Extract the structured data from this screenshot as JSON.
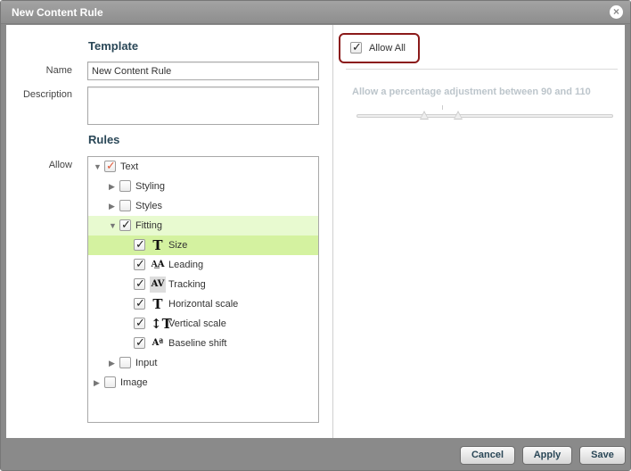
{
  "window": {
    "title": "New Content Rule"
  },
  "template": {
    "heading": "Template",
    "name_label": "Name",
    "name_value": "New Content Rule",
    "description_label": "Description",
    "description_value": ""
  },
  "rules": {
    "heading": "Rules",
    "allow_label": "Allow",
    "tree": [
      {
        "label": "Text",
        "expanded": true,
        "checked": true,
        "partial": true
      },
      {
        "label": "Styling",
        "expanded": false,
        "checked": false
      },
      {
        "label": "Styles",
        "expanded": false,
        "checked": false
      },
      {
        "label": "Fitting",
        "expanded": true,
        "checked": true
      },
      {
        "label": "Size",
        "checked": true,
        "icon": "font-size-icon"
      },
      {
        "label": "Leading",
        "checked": true,
        "icon": "leading-icon"
      },
      {
        "label": "Tracking",
        "checked": true,
        "icon": "tracking-icon"
      },
      {
        "label": "Horizontal scale",
        "checked": true,
        "icon": "horizontal-scale-icon"
      },
      {
        "label": "Vertical scale",
        "checked": true,
        "icon": "vertical-scale-icon"
      },
      {
        "label": "Baseline shift",
        "checked": true,
        "icon": "baseline-shift-icon"
      },
      {
        "label": "Input",
        "expanded": false,
        "checked": false
      },
      {
        "label": "Image",
        "expanded": false,
        "checked": false
      }
    ]
  },
  "right_panel": {
    "allow_all_label": "Allow All",
    "allow_all_checked": true,
    "adjustment_text": "Allow a percentage adjustment between 90 and 110",
    "range_min": 90,
    "range_max": 110
  },
  "buttons": {
    "cancel": "Cancel",
    "apply": "Apply",
    "save": "Save"
  },
  "colors": {
    "accent": "#2a4757",
    "highlight_light": "#e8fad0",
    "highlight_strong": "#d4f2a0",
    "allow_all_border": "#8b1a1a"
  }
}
